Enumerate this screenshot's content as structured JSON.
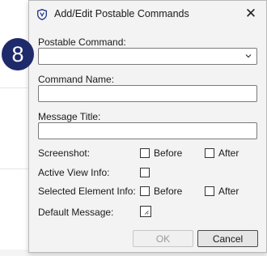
{
  "dialog": {
    "title": "Add/Edit Postable Commands",
    "close_glyph": "✕",
    "app_icon": "shield-v-icon"
  },
  "badge": {
    "number": "8",
    "color": "#1f2a6b"
  },
  "form": {
    "postable_command": {
      "label": "Postable Command:",
      "value": "",
      "type": "dropdown"
    },
    "command_name": {
      "label": "Command Name:",
      "value": ""
    },
    "message_title": {
      "label": "Message Title:",
      "value": ""
    },
    "screenshot": {
      "label": "Screenshot:",
      "before_label": "Before",
      "before_checked": false,
      "after_label": "After",
      "after_checked": false
    },
    "active_view_info": {
      "label": "Active View Info:",
      "checked": false
    },
    "selected_element_info": {
      "label": "Selected Element Info:",
      "before_label": "Before",
      "before_checked": false,
      "after_label": "After",
      "after_checked": false
    },
    "default_message": {
      "label": "Default Message:",
      "checked": false
    }
  },
  "buttons": {
    "ok_label": "OK",
    "cancel_label": "Cancel"
  }
}
